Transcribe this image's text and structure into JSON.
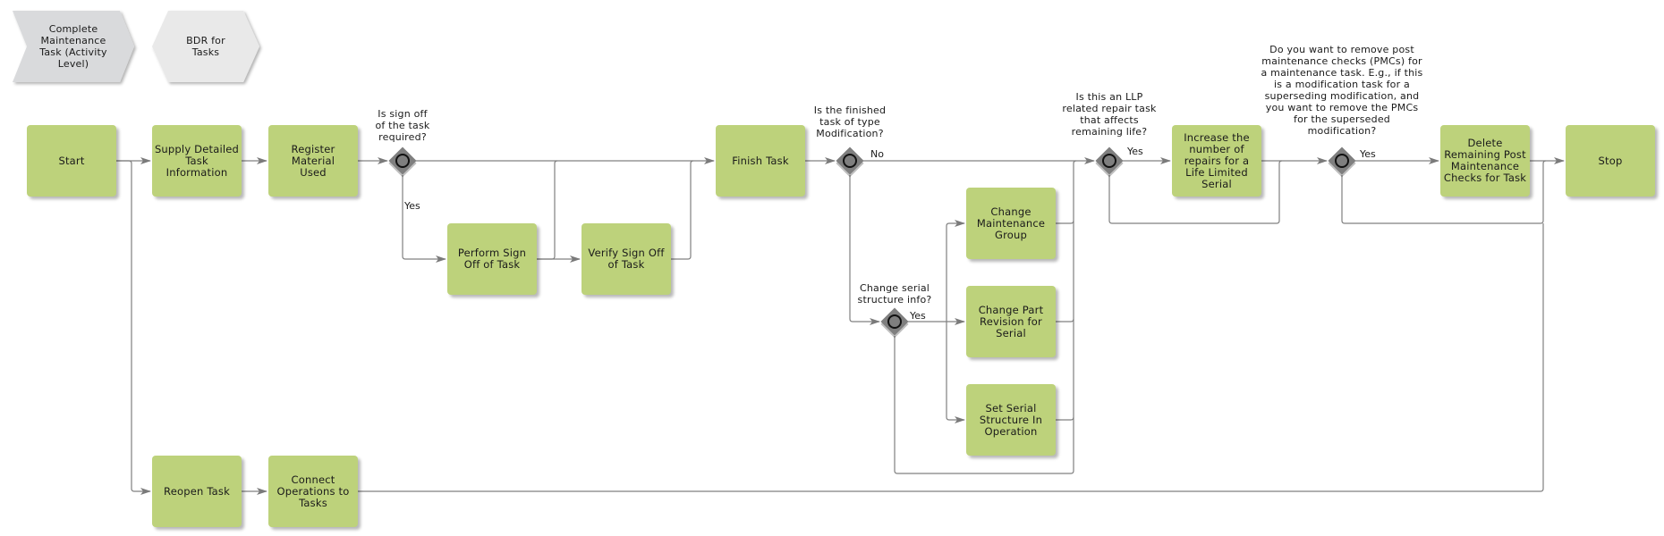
{
  "header": {
    "process_map_items": [
      {
        "label": "Complete\nMaintenance\nTask (Activity\nLevel)",
        "shape": "chevron",
        "color": "#d9dadc"
      },
      {
        "label": "BDR for\nTasks",
        "shape": "hexagon",
        "color": "#e9e9e9"
      }
    ]
  },
  "colors": {
    "task_fill": "#bdd27b",
    "gateway_fill": "#7f7f7f",
    "connector": "#808080"
  },
  "tasks": {
    "start": "Start",
    "supply_detailed": "Supply Detailed Task Information",
    "register_material": "Register Material Used",
    "perform_sign_off": "Perform Sign Off of Task",
    "verify_sign_off": "Verify Sign Off of Task",
    "finish_task": "Finish Task",
    "change_maintenance_group": "Change Maintenance Group",
    "change_part_revision": "Change Part Revision for Serial",
    "set_serial_structure": "Set Serial Structure In Operation",
    "increase_repairs": "Increase the number of repairs for a Life Limited Serial",
    "delete_pmcs": "Delete Remaining Post Maintenance Checks for Task",
    "stop": "Stop",
    "reopen_task": "Reopen Task",
    "connect_operations": "Connect Operations to Tasks"
  },
  "gateways": {
    "sign_off_required": "Is sign off\nof the task\nrequired?",
    "type_modification": "Is the finished\ntask of type\nModification?",
    "change_serial_info": "Change serial\nstructure info?",
    "llp_repair": "Is this an LLP\nrelated repair task\nthat affects\nremaining life?",
    "remove_pmcs": "Do you want to remove post\nmaintenance checks (PMCs) for\na maintenance task. E.g., if this\nis a modification task for a\nsuperseding modification, and\nyou want to remove the PMCs\nfor the superseded\nmodification?"
  },
  "edge_labels": {
    "sign_off_yes": "Yes",
    "modification_no": "No",
    "serial_yes": "Yes",
    "llp_yes": "Yes",
    "pmc_yes": "Yes"
  }
}
